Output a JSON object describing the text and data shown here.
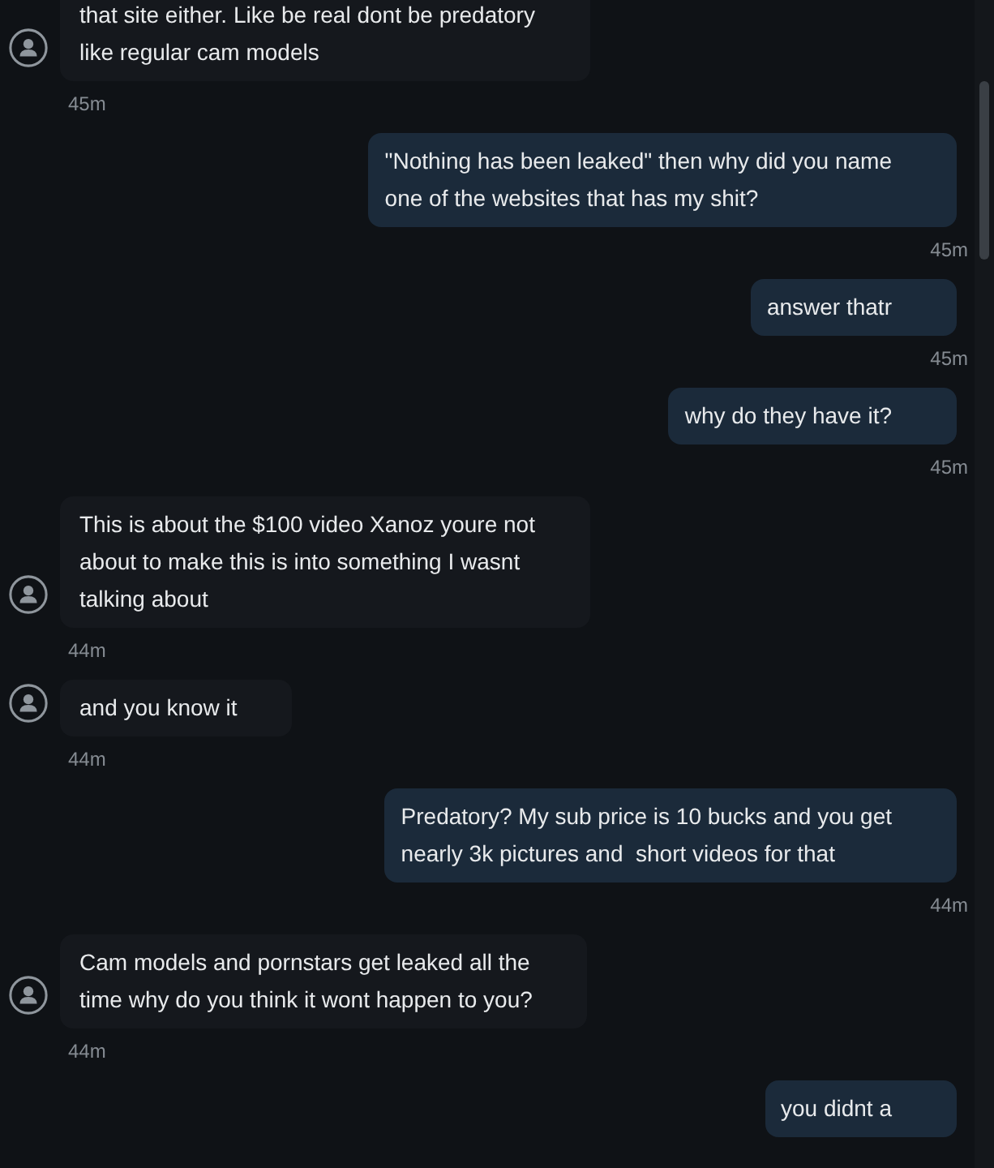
{
  "messages": [
    {
      "kind": "incoming",
      "text": "that site either. Like be real dont be predatory\nlike regular cam models",
      "time": "45m"
    },
    {
      "kind": "outgoing",
      "text": "\"Nothing has been leaked\" then why did you name\none of the websites that has my shit?",
      "time": "45m"
    },
    {
      "kind": "outgoing",
      "text": "answer thatr",
      "time": "45m"
    },
    {
      "kind": "outgoing",
      "text": "why do they have it?",
      "time": "45m"
    },
    {
      "kind": "incoming",
      "text": "This is about the $100 video Xanoz youre not\nabout to make this is into something I wasnt\ntalking about",
      "time": "44m"
    },
    {
      "kind": "incoming",
      "text": "and you know it",
      "time": "44m"
    },
    {
      "kind": "outgoing",
      "text": "Predatory? My sub price is 10 bucks and you get\nnearly 3k pictures and  short videos for that",
      "time": "44m"
    },
    {
      "kind": "incoming",
      "text": "Cam models and pornstars get leaked all the\ntime why do you think it wont happen to you?",
      "time": "44m"
    },
    {
      "kind": "outgoing",
      "text": "you didnt a"
    }
  ]
}
